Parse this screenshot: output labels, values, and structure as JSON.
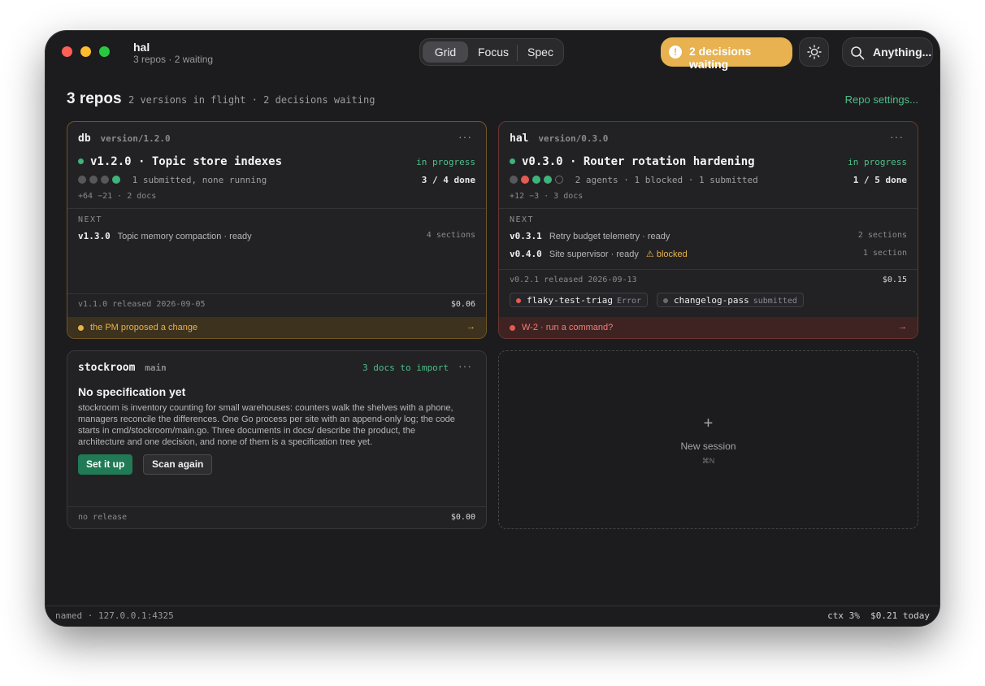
{
  "window": {
    "title": "hal",
    "subtitle": "3 repos · 2 waiting"
  },
  "view_switch": {
    "options": [
      "Grid",
      "Focus",
      "Spec"
    ],
    "selected": "Grid"
  },
  "decisions_button": {
    "icon": "alert-icon",
    "label": "2 decisions waiting",
    "color": "#e7b24f"
  },
  "theme_toggle": {
    "icon": "sun-icon"
  },
  "search": {
    "icon": "search-icon",
    "label": "Anything..."
  },
  "header": {
    "title": "3 repos",
    "summary": "2 versions in flight · 2 decisions waiting",
    "settings_link": "Repo settings..."
  },
  "cards": {
    "db": {
      "repo": "db",
      "branch": "version/1.2.0",
      "menu": "···",
      "version_title": "v1.2.0 · Topic store indexes",
      "status": "in progress",
      "progress_text": "1 submitted, none running",
      "done": "3 / 4 done",
      "diffstat": "+64 −21 · 2 docs",
      "next_label": "NEXT",
      "next": [
        {
          "version": "v1.3.0",
          "desc": "Topic memory compaction · ready",
          "warning": "",
          "sections": "4 sections"
        }
      ],
      "release": "v1.1.0 released 2026-09-05",
      "cost": "$0.06",
      "banner": "the PM proposed a change",
      "banner_arrow": "→"
    },
    "hal": {
      "repo": "hal",
      "branch": "version/0.3.0",
      "menu": "···",
      "version_title": "v0.3.0 · Router rotation hardening",
      "status": "in progress",
      "progress_text": "2 agents · 1 blocked · 1 submitted",
      "done": "1 / 5 done",
      "diffstat": "+12 −3 · 3 docs",
      "next_label": "NEXT",
      "next": [
        {
          "version": "v0.3.1",
          "desc": "Retry budget telemetry · ready",
          "warning": "",
          "sections": "2 sections"
        },
        {
          "version": "v0.4.0",
          "desc": "Site supervisor · ready",
          "warning": "⚠ blocked",
          "sections": "1 section"
        }
      ],
      "release": "v0.2.1 released 2026-09-13",
      "cost": "$0.15",
      "chips": [
        {
          "name": "flaky-test-triag",
          "state": "Error",
          "color": "#e25c53"
        },
        {
          "name": "changelog-pass",
          "state": "submitted",
          "color": "#6a6a6e"
        }
      ],
      "banner": "W-2 · run a command?",
      "banner_arrow": "→"
    },
    "stockroom": {
      "repo": "stockroom",
      "branch": "main",
      "import_link": "3 docs to import",
      "menu": "···",
      "title": "No specification yet",
      "description": "stockroom is inventory counting for small warehouses: counters walk the shelves with a phone, managers reconcile the differences. One Go process per site with an append-only log; the code starts in cmd/stockroom/main.go. Three documents in docs/ describe the product, the architecture and one decision, and none of them is a specification tree yet.",
      "primary_button": "Set it up",
      "secondary_button": "Scan again",
      "release": "no release",
      "cost": "$0.00"
    }
  },
  "new_session": {
    "icon": "plus-icon",
    "label": "New session",
    "shortcut": "⌘N"
  },
  "statusbar": {
    "left": "named · 127.0.0.1:4325",
    "ctx": "ctx 3%",
    "cost_today": "$0.21 today"
  },
  "colors": {
    "accent_green": "#4fbf8a",
    "warning_amber": "#e7b24f",
    "error_red": "#e25c53"
  }
}
